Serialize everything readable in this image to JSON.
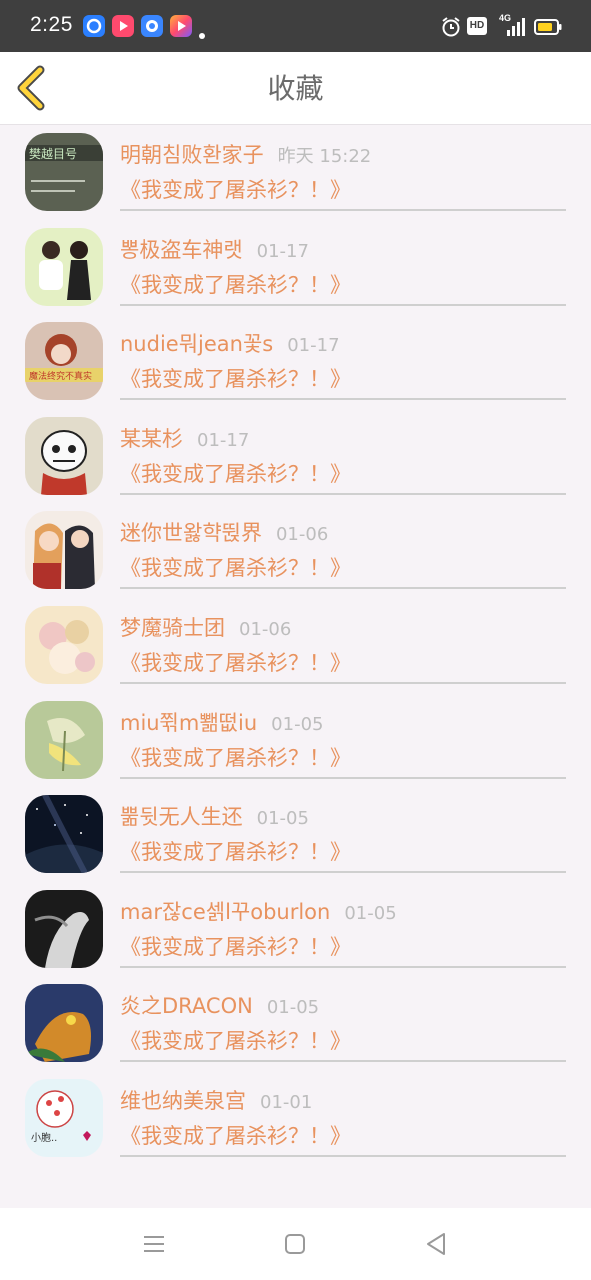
{
  "status_bar": {
    "time": "2:25",
    "app_icons": [
      {
        "name": "qq-browser-icon",
        "color": "#2b7fff"
      },
      {
        "name": "video-app-icon",
        "color": "#ff4a6e"
      },
      {
        "name": "camera-app-icon",
        "color": "#3a86ff"
      },
      {
        "name": "media-player-icon",
        "color": "#ff7b3d"
      }
    ],
    "hd_label": "HD",
    "network_label": "4G",
    "battery_color": "#ffd21f"
  },
  "header": {
    "title": "收藏",
    "back_icon": "chevron-left-icon",
    "back_icon_color": "#ffd43b"
  },
  "colors": {
    "accent": "#e8925e",
    "time": "#bdbdbd"
  },
  "items": [
    {
      "name": "明朝침败환家子",
      "time": "昨天 15:22",
      "title": "《我变成了屠杀衫？！》"
    },
    {
      "name": "뽕极盗车神랫",
      "time": "01-17",
      "title": "《我变成了屠杀衫？！》"
    },
    {
      "name": "nudie뭐jean꽃s",
      "time": "01-17",
      "title": "《我变成了屠杀衫？！》"
    },
    {
      "name": "某某杉",
      "time": "01-17",
      "title": "《我变成了屠杀衫？！》"
    },
    {
      "name": "迷你世왏햑뛵界",
      "time": "01-06",
      "title": "《我变成了屠杀衫？！》"
    },
    {
      "name": "梦魔骑士团",
      "time": "01-06",
      "title": "《我变成了屠杀衫？！》"
    },
    {
      "name": "miu쮞m뾂떲iu",
      "time": "01-05",
      "title": "《我变成了屠杀衫？！》"
    },
    {
      "name": "뿖뒷无人生还",
      "time": "01-05",
      "title": "《我变成了屠杀衫？！》"
    },
    {
      "name": "mar잖ce셁l꾸oburlon",
      "time": "01-05",
      "title": "《我变成了屠杀衫？！》"
    },
    {
      "name": "炎之DRACON",
      "time": "01-05",
      "title": "《我变成了屠杀衫？！》"
    },
    {
      "name": "维也纳美泉宫",
      "time": "01-01",
      "title": "《我变成了屠杀衫？！》"
    }
  ],
  "nav_bar": {
    "menu_icon": "menu-icon",
    "home_icon": "home-square-icon",
    "back_icon": "back-triangle-icon"
  }
}
